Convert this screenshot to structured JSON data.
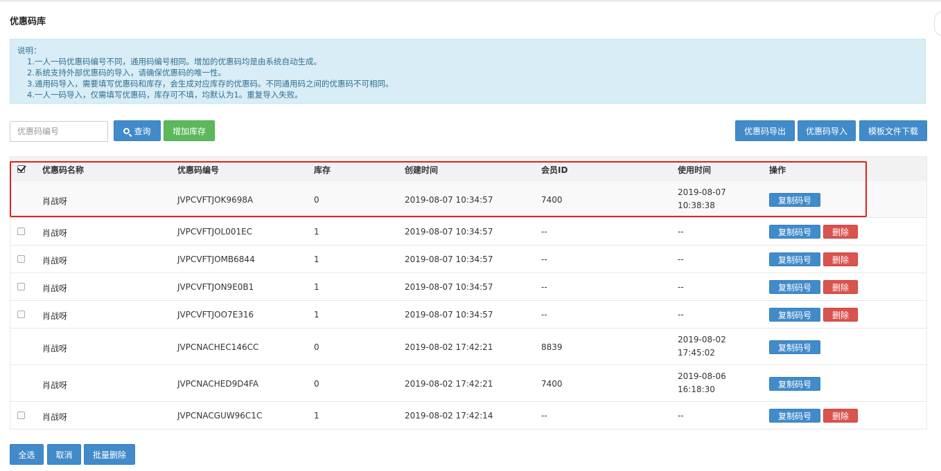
{
  "page": {
    "title": "优惠码库"
  },
  "notice": {
    "heading": "说明：",
    "lines": [
      "1.一人一码优惠码编号不同，通用码编号相同。增加的优惠码均是由系统自动生成。",
      "2.系统支持外部优惠码的导入，请确保优惠码的唯一性。",
      "3.通用码导入，需要填写优惠码和库存，会生成对应库存的优惠码。不同通用码之间的优惠码不可相同。",
      "4.一人一码导入，仅需填写优惠码，库存可不填，均默认为1。重复导入失败。"
    ]
  },
  "toolbar": {
    "search_placeholder": "优惠码编号",
    "query_label": "查询",
    "add_stock_label": "增加库存",
    "export_label": "优惠码导出",
    "import_label": "优惠码导入",
    "template_label": "模板文件下载"
  },
  "table": {
    "columns": [
      "优惠码名称",
      "优惠码编号",
      "库存",
      "创建时间",
      "会员ID",
      "使用时间",
      "操作"
    ],
    "copy_label": "复制码号",
    "delete_label": "删除",
    "rows": [
      {
        "name": "肖战呀",
        "code": "JVPCVFTJOK9698A",
        "stock": "0",
        "created": "2019-08-07 10:34:57",
        "member": "7400",
        "used": [
          "2019-08-07",
          "10:38:38"
        ]
      },
      {
        "name": "肖战呀",
        "code": "JVPCVFTJOL001EC",
        "stock": "1",
        "created": "2019-08-07 10:34:57",
        "member": "--",
        "used": [
          "--"
        ]
      },
      {
        "name": "肖战呀",
        "code": "JVPCVFTJOMB6844",
        "stock": "1",
        "created": "2019-08-07 10:34:57",
        "member": "--",
        "used": [
          "--"
        ]
      },
      {
        "name": "肖战呀",
        "code": "JVPCVFTJON9E0B1",
        "stock": "1",
        "created": "2019-08-07 10:34:57",
        "member": "--",
        "used": [
          "--"
        ]
      },
      {
        "name": "肖战呀",
        "code": "JVPCVFTJOO7E316",
        "stock": "1",
        "created": "2019-08-07 10:34:57",
        "member": "--",
        "used": [
          "--"
        ]
      },
      {
        "name": "肖战呀",
        "code": "JVPCNACHEC146CC",
        "stock": "0",
        "created": "2019-08-02 17:42:21",
        "member": "8839",
        "used": [
          "2019-08-02",
          "17:45:02"
        ]
      },
      {
        "name": "肖战呀",
        "code": "JVPCNACHED9D4FA",
        "stock": "0",
        "created": "2019-08-02 17:42:21",
        "member": "7400",
        "used": [
          "2019-08-06",
          "16:18:30"
        ]
      },
      {
        "name": "肖战呀",
        "code": "JVPCNACGUW96C1C",
        "stock": "1",
        "created": "2019-08-02 17:42:14",
        "member": "--",
        "used": [
          "--"
        ]
      }
    ]
  },
  "footer": {
    "select_all_label": "全选",
    "cancel_label": "取消",
    "batch_delete_label": "批量删除"
  },
  "colors": {
    "primary": "#428bca",
    "success": "#5cb85c",
    "danger": "#d9534f",
    "notice_bg": "#d9edf7",
    "highlight": "#e02020"
  }
}
